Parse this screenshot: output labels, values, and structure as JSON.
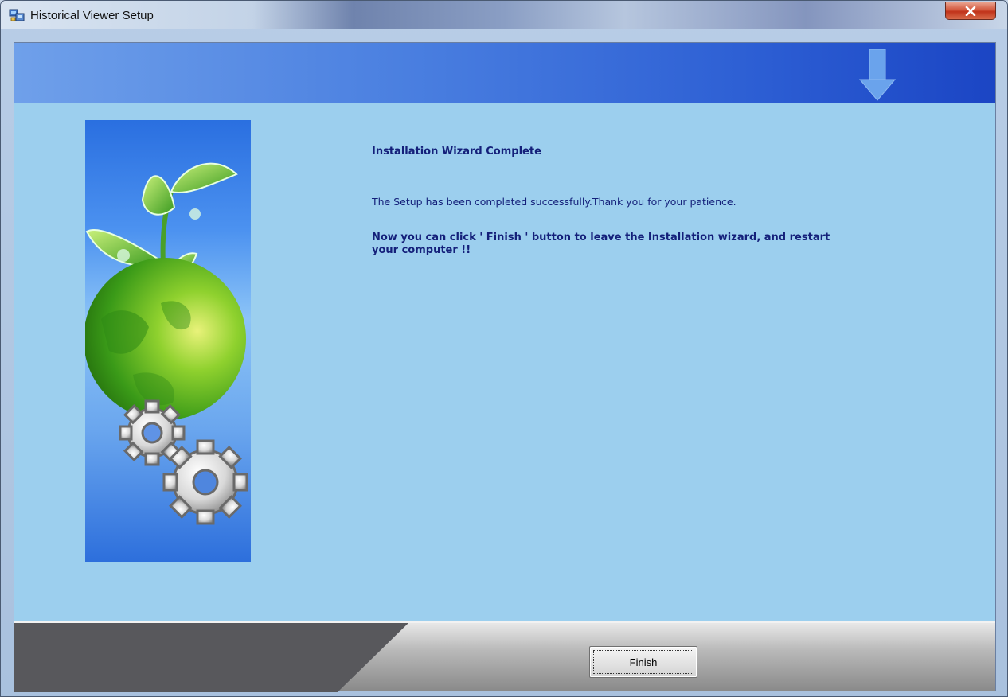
{
  "window": {
    "title": "Historical Viewer Setup",
    "close_label": "x"
  },
  "content": {
    "heading": "Installation Wizard Complete",
    "message": "The Setup has been completed  successfully.Thank you for your patience.",
    "instruction": "Now you can click ' Finish ' button to leave the Installation wizard, and restart your computer !!"
  },
  "footer": {
    "finish_label": "Finish"
  },
  "icons": {
    "app": "setup-computer-icon",
    "banner": "download-arrow-icon",
    "side": "globe-plant-gears-illustration"
  },
  "colors": {
    "text": "#14207a",
    "content_bg": "#9ccfee",
    "banner_start": "#6fa0ea",
    "banner_end": "#1b45c4",
    "close_button": "#c0331a"
  }
}
